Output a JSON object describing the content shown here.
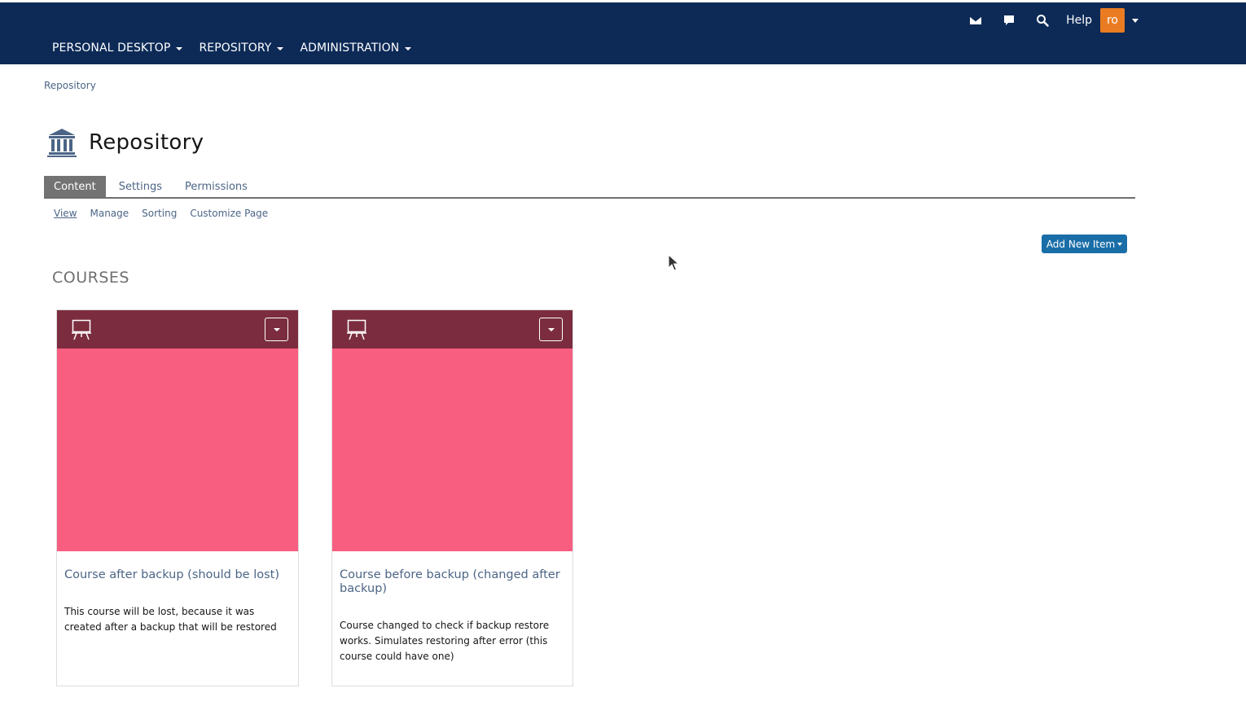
{
  "topbar": {
    "icons": [
      "mail-icon",
      "chat-icon",
      "search-icon"
    ],
    "help_label": "Help",
    "avatar_initials": "ro",
    "colors": {
      "background": "#0d2a57",
      "avatar": "#e97c22"
    }
  },
  "mainnav": {
    "items": [
      {
        "label": "PERSONAL DESKTOP"
      },
      {
        "label": "REPOSITORY"
      },
      {
        "label": "ADMINISTRATION"
      }
    ]
  },
  "breadcrumb": {
    "label": "Repository"
  },
  "page": {
    "title": "Repository",
    "icon": "repository-icon"
  },
  "tabs": [
    {
      "label": "Content",
      "active": true
    },
    {
      "label": "Settings"
    },
    {
      "label": "Permissions"
    }
  ],
  "subtabs": [
    {
      "label": "View",
      "active": true
    },
    {
      "label": "Manage"
    },
    {
      "label": "Sorting"
    },
    {
      "label": "Customize Page"
    }
  ],
  "actions": {
    "add_new_item": "Add New Item"
  },
  "section": {
    "title": "COURSES"
  },
  "courses": [
    {
      "title": "Course after backup (should be lost)",
      "description": "This course will be lost, because it was created after a backup that will be restored",
      "icon": "course-icon"
    },
    {
      "title": "Course before backup (changed after backup)",
      "description": "Course changed to check if backup restore works. Simulates restoring after error (this course could have one)",
      "icon": "course-icon"
    }
  ],
  "colors": {
    "card_header": "#7b2d3f",
    "card_image": "#f75e80",
    "primary_button": "#1a6ea8",
    "link": "#4c6586"
  }
}
